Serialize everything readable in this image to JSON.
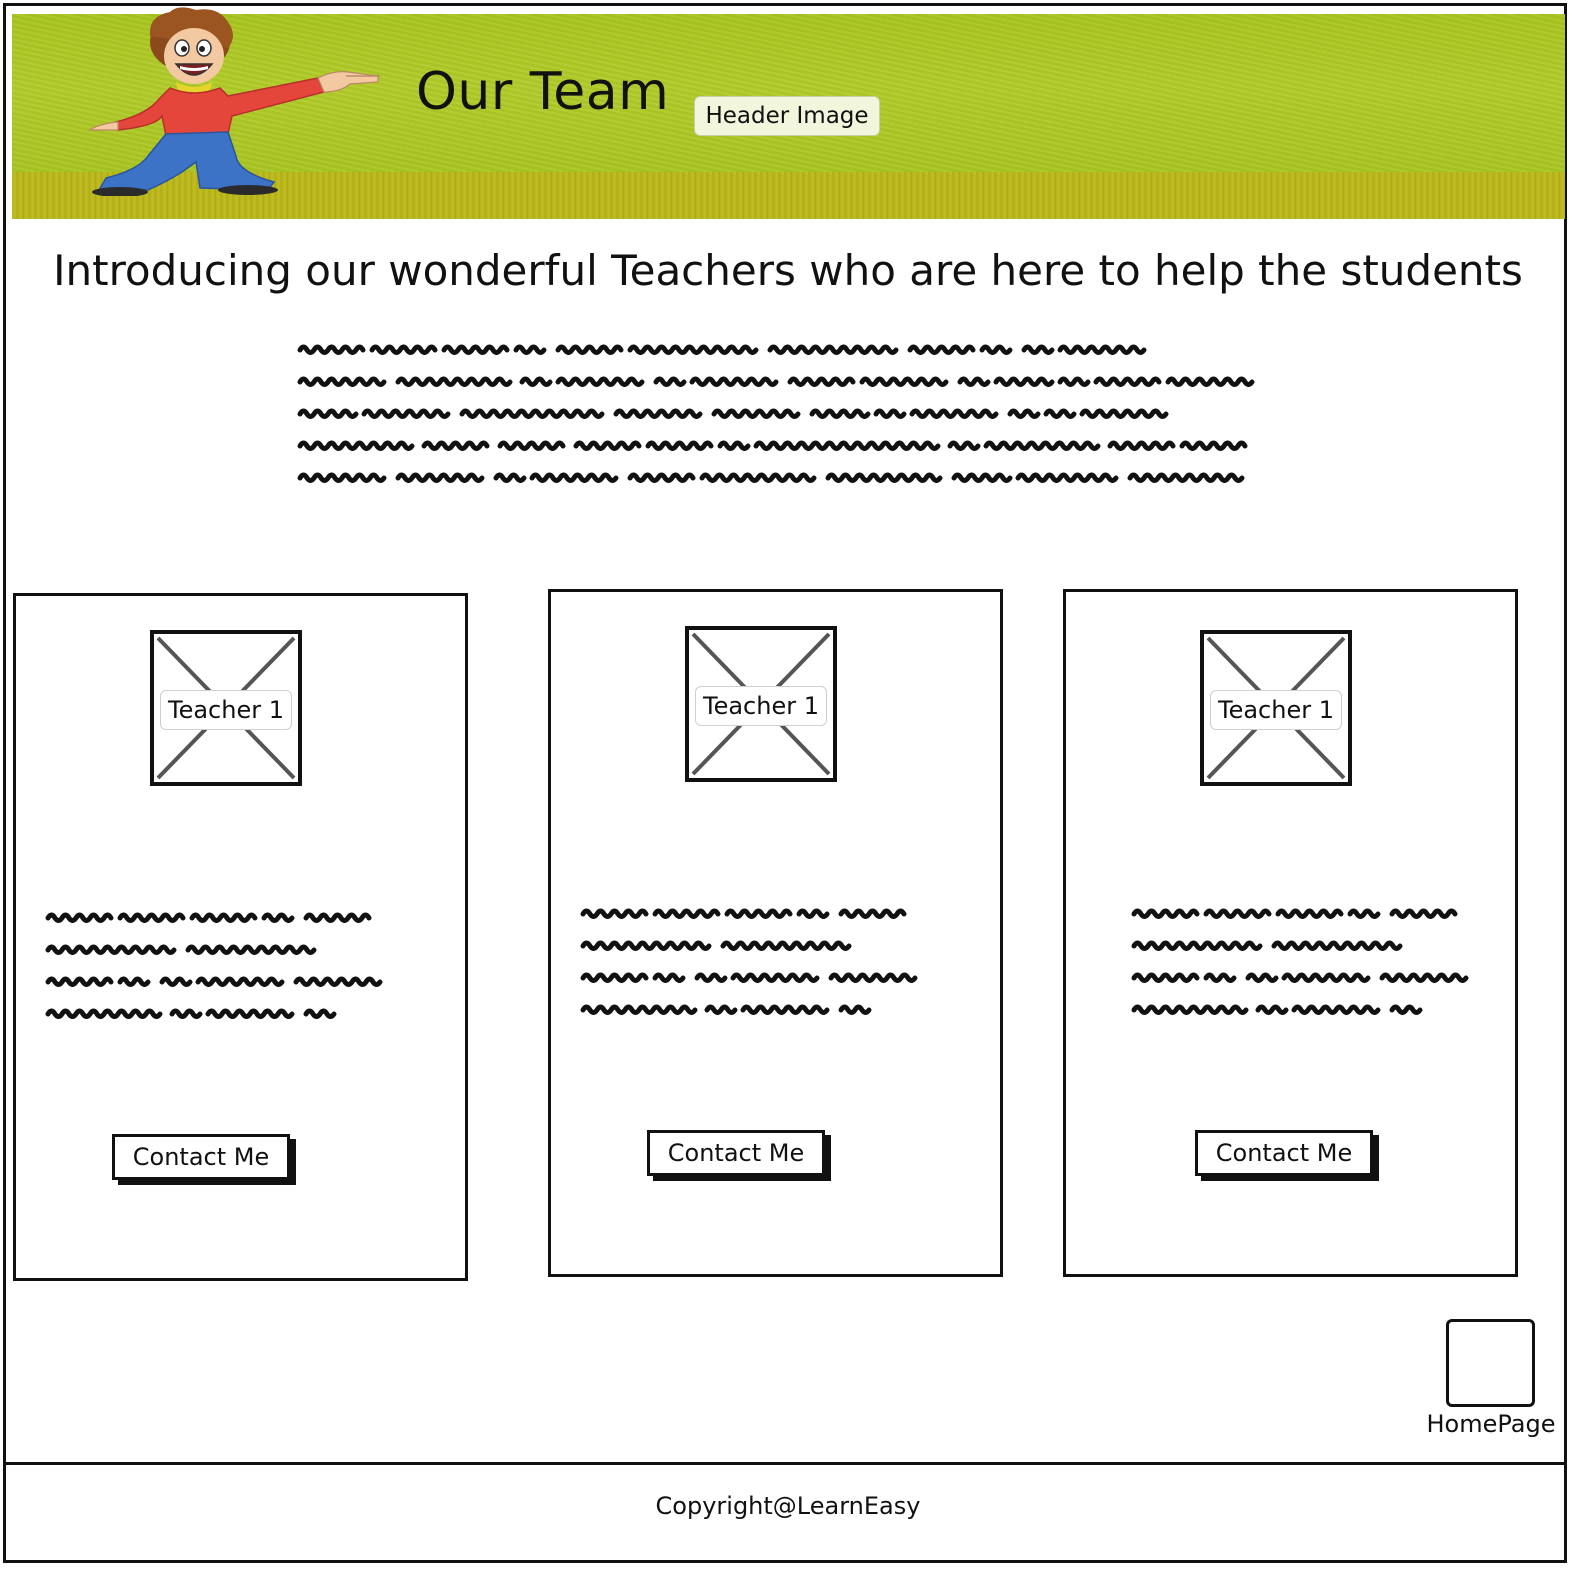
{
  "header": {
    "title": "Our Team",
    "image_label": "Header Image"
  },
  "intro": {
    "heading": "Introducing our wonderful Teachers who are here to help the students"
  },
  "teachers": [
    {
      "image_label": "Teacher 1",
      "button_label": "Contact Me"
    },
    {
      "image_label": "Teacher 1",
      "button_label": "Contact Me"
    },
    {
      "image_label": "Teacher 1",
      "button_label": "Contact Me"
    }
  ],
  "nav": {
    "home_label": "HomePage"
  },
  "footer": {
    "copyright": "Copyright@LearnEasy"
  },
  "colors": {
    "banner_green": "#a9c521",
    "banner_strip": "#b7b51a",
    "ink": "#111111"
  },
  "icons": {
    "header_character": "cartoon-character-icon",
    "image_placeholder": "image-placeholder-icon"
  }
}
